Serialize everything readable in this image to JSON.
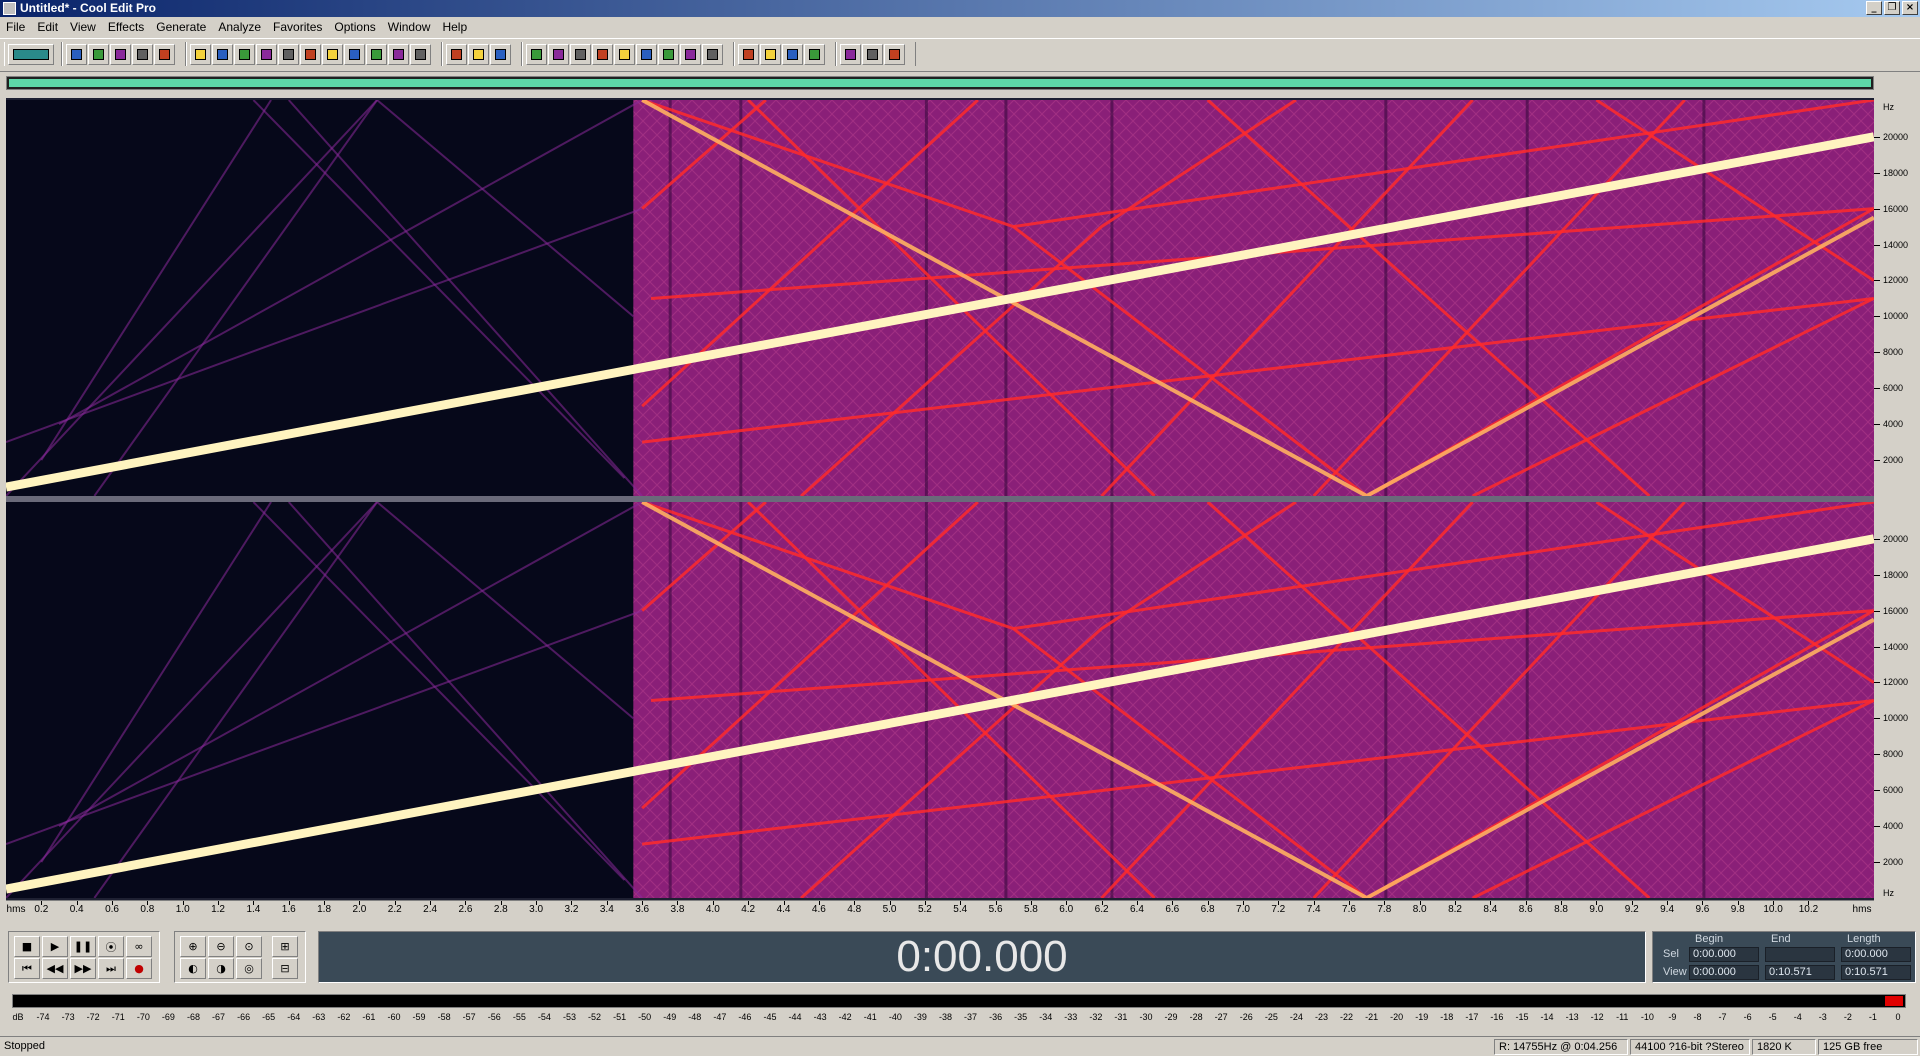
{
  "window": {
    "title": "Untitled* - Cool Edit Pro",
    "min_glyph": "_",
    "restore_glyph": "❐",
    "close_glyph": "×"
  },
  "menu": [
    "File",
    "Edit",
    "View",
    "Effects",
    "Generate",
    "Analyze",
    "Favorites",
    "Options",
    "Window",
    "Help"
  ],
  "toolbar": {
    "icons": [
      "multitrack-toggle-icon",
      "new-icon",
      "open-icon",
      "save-icon",
      "save-as-icon",
      "close-file-icon",
      "undo-icon",
      "redo-icon",
      "repeat-icon",
      "copy-icon",
      "cut-icon",
      "paste-icon",
      "paste-new-icon",
      "mix-paste-icon",
      "trim-icon",
      "delete-silence-icon",
      "select-entire-icon",
      "waveform-view-icon",
      "spectral-view-icon",
      "spectral-bars-icon",
      "marker-icon",
      "play-icon",
      "zoom-icon",
      "loop-icon",
      "mark-icon",
      "cue-list-icon",
      "analysis-icon",
      "frequency-icon",
      "help-icon",
      "envelope-icon",
      "fx-icon",
      "noise-icon",
      "stretch-icon",
      "settings-icon",
      "meter-icon",
      "expand-icon"
    ]
  },
  "frequency_axis": {
    "unit_label": "Hz",
    "ticks": [
      20000,
      18000,
      16000,
      14000,
      12000,
      10000,
      8000,
      6000,
      4000,
      2000
    ],
    "max": 22050
  },
  "time_axis": {
    "start_label": "hms",
    "end_label": "hms",
    "ticks": [
      "0.2",
      "0.4",
      "0.6",
      "0.8",
      "1.0",
      "1.2",
      "1.4",
      "1.6",
      "1.8",
      "2.0",
      "2.2",
      "2.4",
      "2.6",
      "2.8",
      "3.0",
      "3.2",
      "3.4",
      "3.6",
      "3.8",
      "4.0",
      "4.2",
      "4.4",
      "4.6",
      "4.8",
      "5.0",
      "5.2",
      "5.4",
      "5.6",
      "5.8",
      "6.0",
      "6.2",
      "6.4",
      "6.6",
      "6.8",
      "7.0",
      "7.2",
      "7.4",
      "7.6",
      "7.8",
      "8.0",
      "8.2",
      "8.4",
      "8.6",
      "8.8",
      "9.0",
      "9.2",
      "9.4",
      "9.6",
      "9.8",
      "10.0",
      "10.2"
    ],
    "duration_s": 10.571
  },
  "transport": {
    "time_display": "0:00.000",
    "buttons": [
      "stop",
      "play",
      "pause",
      "play-to-end",
      "loop",
      "go-to-start",
      "rewind",
      "fast-forward",
      "go-to-end",
      "record"
    ],
    "zoom_buttons": [
      "zoom-in-horizontal",
      "zoom-out-horizontal",
      "zoom-full",
      "zoom-in-vertical",
      "zoom-in-left",
      "zoom-in-right",
      "zoom-selection",
      "zoom-out-vertical"
    ]
  },
  "selection": {
    "headers": {
      "begin": "Begin",
      "end": "End",
      "length": "Length"
    },
    "sel_label": "Sel",
    "view_label": "View",
    "sel_begin": "0:00.000",
    "sel_end": "",
    "sel_length": "0:00.000",
    "view_begin": "0:00.000",
    "view_end": "0:10.571",
    "view_length": "0:10.571"
  },
  "level_meter": {
    "labels": [
      "dB",
      "-74",
      "-73",
      "-72",
      "-71",
      "-70",
      "-69",
      "-68",
      "-67",
      "-66",
      "-65",
      "-64",
      "-63",
      "-62",
      "-61",
      "-60",
      "-59",
      "-58",
      "-57",
      "-56",
      "-55",
      "-54",
      "-53",
      "-52",
      "-51",
      "-50",
      "-49",
      "-48",
      "-47",
      "-46",
      "-45",
      "-44",
      "-43",
      "-42",
      "-41",
      "-40",
      "-39",
      "-38",
      "-37",
      "-36",
      "-35",
      "-34",
      "-33",
      "-32",
      "-31",
      "-30",
      "-29",
      "-28",
      "-27",
      "-26",
      "-25",
      "-24",
      "-23",
      "-22",
      "-21",
      "-20",
      "-19",
      "-18",
      "-17",
      "-16",
      "-15",
      "-14",
      "-13",
      "-12",
      "-11",
      "-10",
      "-9",
      "-8",
      "-7",
      "-6",
      "-5",
      "-4",
      "-3",
      "-2",
      "-1",
      "0"
    ]
  },
  "status": {
    "state": "Stopped",
    "cursor": "R: 14755Hz @   0:04.256",
    "format": "44100 ?16-bit ?Stereo",
    "size": "1820 K",
    "free": "125 GB free"
  },
  "colors": {
    "spectrum_bg": "#06081a",
    "sweep_main": "#fff4c0",
    "sweep_red": "#ff2a2a",
    "sweep_purple": "#8a2a9a",
    "noise_fill": "#8a1f78",
    "overview_bar": "#5dd8a8",
    "display_bg": "#3a4a57",
    "clip_red": "#e00000"
  }
}
